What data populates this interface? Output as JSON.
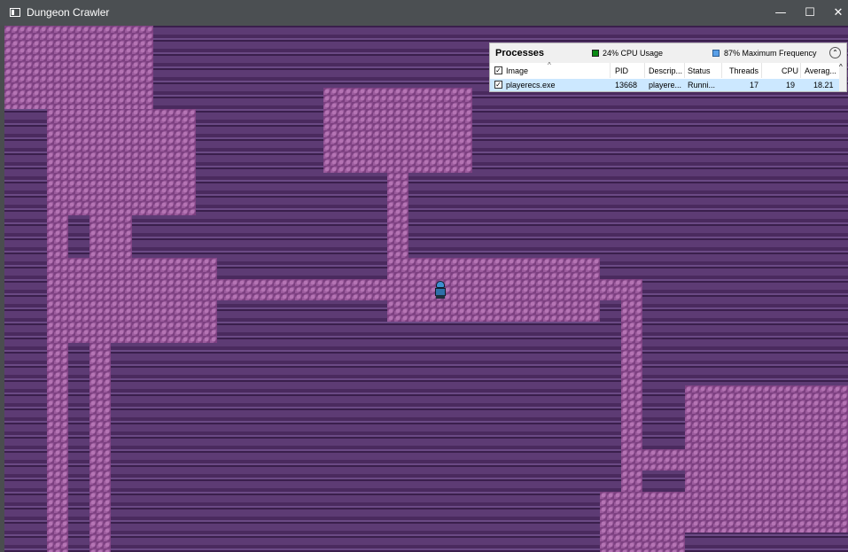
{
  "window": {
    "title": "Dungeon Crawler",
    "minimize_glyph": "—",
    "maximize_glyph": "☐",
    "close_glyph": "✕"
  },
  "overlay": {
    "title": "Processes",
    "cpu_usage": "24% CPU Usage",
    "max_frequency": "87% Maximum Frequency",
    "collapse_glyph": "⌃",
    "columns": {
      "image": "Image",
      "pid": "PID",
      "description": "Descrip...",
      "status": "Status",
      "threads": "Threads",
      "cpu": "CPU",
      "average": "Averag..."
    },
    "row": {
      "image": "playerecs.exe",
      "pid": "13668",
      "description": "playere...",
      "status": "Runni...",
      "threads": "17",
      "cpu": "19",
      "average": "18.21"
    },
    "colors": {
      "cpu_indicator": "#0a8a14",
      "freq_indicator": "#5aa0e8"
    }
  },
  "game": {
    "wall_color": "#56346c",
    "floor_color": "#9a5a9c",
    "player": "knight-sprite"
  }
}
